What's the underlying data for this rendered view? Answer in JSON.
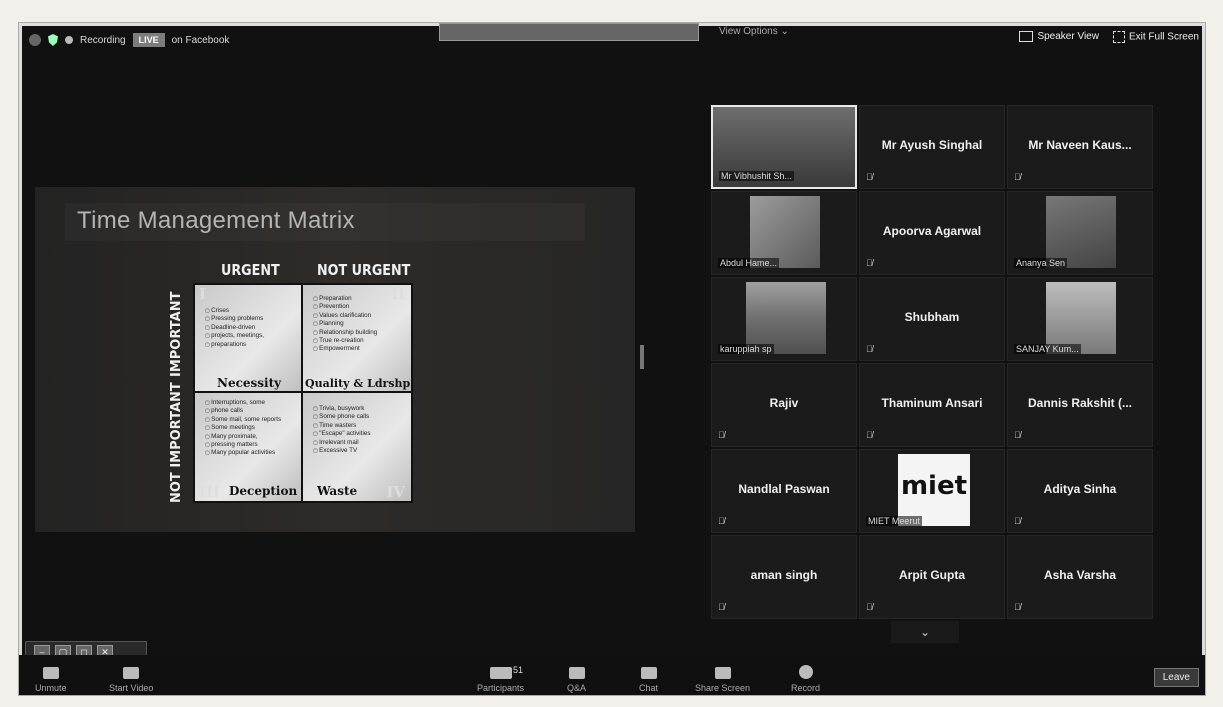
{
  "topbar": {
    "recording": "Recording",
    "live": "LIVE",
    "on_facebook": "on Facebook",
    "view_options": "View Options ⌄",
    "speaker_view": "Speaker View",
    "exit_full_screen": "Exit Full Screen"
  },
  "slide": {
    "title": "Time Management Matrix",
    "col_urgent": "URGENT",
    "col_not_urgent": "NOT URGENT",
    "row_important": "IMPORTANT",
    "row_not_important": "NOT IMPORTANT",
    "q1": {
      "num": "I",
      "label": "Necessity",
      "items": [
        "Crises",
        "Pressing problems",
        "Deadline-driven",
        "projects, meetings,",
        "preparations"
      ]
    },
    "q2": {
      "num": "II",
      "label": "Quality & Ldrshp",
      "items": [
        "Preparation",
        "Prevention",
        "Values clarification",
        "Planning",
        "Relationship building",
        "True re-creation",
        "Empowerment"
      ]
    },
    "q3": {
      "num": "III",
      "label": "Deception",
      "items": [
        "Interruptions, some",
        "phone calls",
        "Some mail, some reports",
        "Some meetings",
        "Many proximate,",
        "pressing matters",
        "Many popular activities"
      ]
    },
    "q4": {
      "num": "IV",
      "label": "Waste",
      "items": [
        "Trivia, busywork",
        "Some phone calls",
        "Time wasters",
        "\"Escape\" activities",
        "Irrelevant mail",
        "Excessive TV"
      ]
    }
  },
  "participants": [
    {
      "name": "Mr Vibhushit Sh...",
      "video": true
    },
    {
      "name": "Mr Ayush Singhal"
    },
    {
      "name": "Mr Naveen Kaus..."
    },
    {
      "name": "Abdul Hame...",
      "video": true
    },
    {
      "name": "Apoorva Agarwal"
    },
    {
      "name": "Ananya Sen",
      "video": true
    },
    {
      "name": "karuppiah sp",
      "video": true
    },
    {
      "name": "Shubham"
    },
    {
      "name": "SANJAY Kum...",
      "video": true
    },
    {
      "name": "Rajiv"
    },
    {
      "name": "Thaminum Ansari"
    },
    {
      "name": "Dannis Rakshit (..."
    },
    {
      "name": "Nandlal Paswan"
    },
    {
      "name": "MIET Meerut",
      "video": true,
      "logo": "miet"
    },
    {
      "name": "Aditya Sinha"
    },
    {
      "name": "aman singh"
    },
    {
      "name": "Arpit Gupta"
    },
    {
      "name": "Asha Varsha"
    }
  ],
  "logo_text": "miet",
  "participants_count": "51",
  "bottombar": {
    "unmute": "Unmute",
    "start_video": "Start Video",
    "participants": "Participants",
    "qa": "Q&A",
    "chat": "Chat",
    "share_screen": "Share Screen",
    "record": "Record",
    "leave": "Leave"
  }
}
